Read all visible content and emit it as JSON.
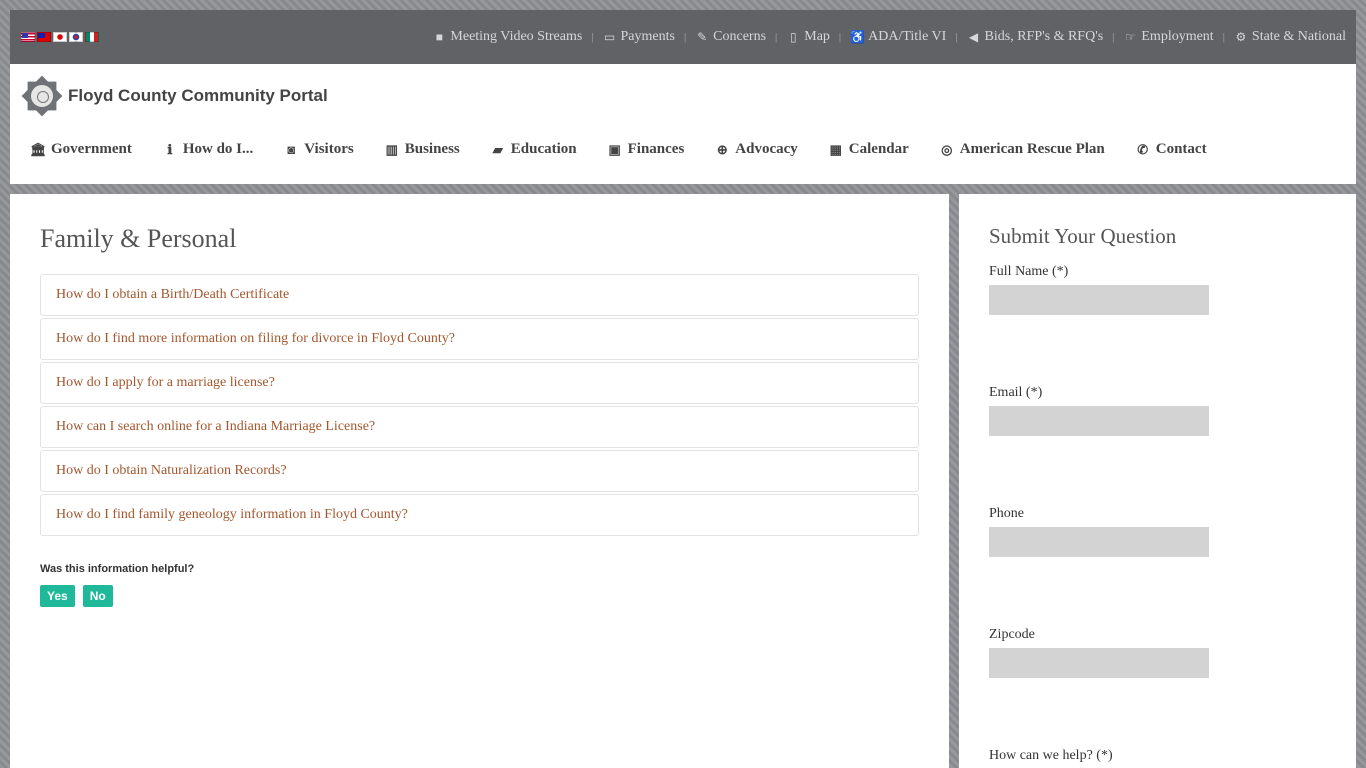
{
  "topbar": {
    "flags": [
      "us-flag-icon",
      "taiwan-flag-icon",
      "japan-flag-icon",
      "korea-flag-icon",
      "mexico-flag-icon"
    ],
    "links": [
      {
        "label": "Meeting Video Streams",
        "icon": "video-camera-icon"
      },
      {
        "label": "Payments",
        "icon": "credit-card-icon"
      },
      {
        "label": "Concerns",
        "icon": "edit-icon"
      },
      {
        "label": "Map",
        "icon": "map-icon"
      },
      {
        "label": "ADA/Title VI",
        "icon": "wheelchair-icon"
      },
      {
        "label": "Bids, RFP's & RFQ's",
        "icon": "bullhorn-icon"
      },
      {
        "label": "Employment",
        "icon": "hand-point-icon"
      },
      {
        "label": "State & National",
        "icon": "cogs-icon"
      }
    ],
    "separator": "|"
  },
  "header": {
    "site_name": "Floyd County Community Portal",
    "nav": [
      {
        "label": "Government",
        "icon": "bank-icon"
      },
      {
        "label": "How do I...",
        "icon": "info-circle-icon"
      },
      {
        "label": "Visitors",
        "icon": "camera-icon"
      },
      {
        "label": "Business",
        "icon": "bar-chart-icon"
      },
      {
        "label": "Education",
        "icon": "book-icon"
      },
      {
        "label": "Finances",
        "icon": "money-icon"
      },
      {
        "label": "Advocacy",
        "icon": "search-plus-icon"
      },
      {
        "label": "Calendar",
        "icon": "calendar-icon"
      },
      {
        "label": "American Rescue Plan",
        "icon": "life-ring-icon"
      },
      {
        "label": "Contact",
        "icon": "phone-icon"
      }
    ]
  },
  "main": {
    "title": "Family & Personal",
    "faqs": [
      "How do I obtain a Birth/Death Certificate",
      "How do I find more information on filing for divorce in Floyd County?",
      "How do I apply for a marriage license?",
      "How can I search online for a Indiana Marriage License?",
      "How do I obtain Naturalization Records?",
      "How do I find family geneology information in Floyd County?"
    ],
    "helpful_question": "Was this information helpful?",
    "yes_label": "Yes",
    "no_label": "No"
  },
  "sidebar": {
    "title": "Submit Your Question",
    "fields": [
      {
        "label": "Full Name (*)"
      },
      {
        "label": "Email (*)"
      },
      {
        "label": "Phone"
      },
      {
        "label": "Zipcode"
      },
      {
        "label": "How can we help? (*)"
      }
    ]
  },
  "colors": {
    "topbar_bg": "#606266",
    "link_brown": "#a3572d",
    "button_teal": "#1fb99a",
    "input_gray": "#d3d3d3"
  }
}
